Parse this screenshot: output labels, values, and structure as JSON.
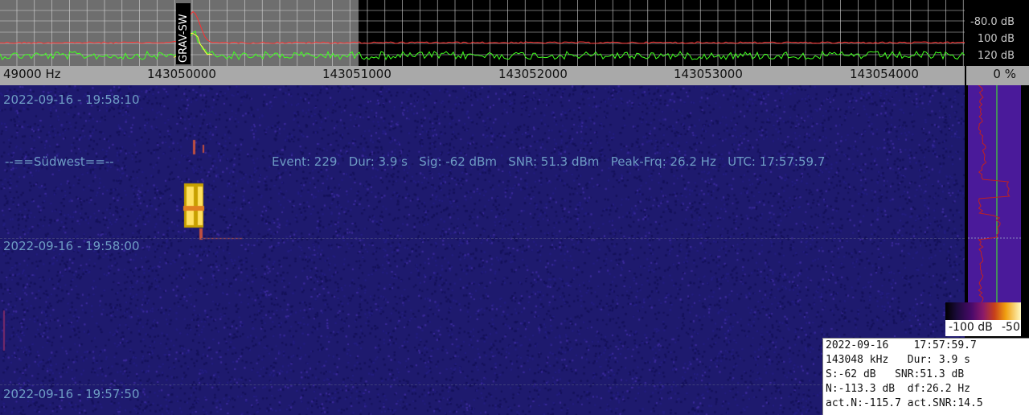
{
  "spectrum": {
    "db_labels": [
      "-80.0 dB",
      "100 dB",
      "120 dB"
    ],
    "marker_label": "GRAV-SW"
  },
  "freq_axis": {
    "labels": [
      "49000 Hz",
      "143050000",
      "143051000",
      "143052000",
      "143053000",
      "143054000"
    ],
    "percent": "0 %"
  },
  "waterfall": {
    "timestamps": [
      "2022-09-16 - 19:58:10",
      "2022-09-16 - 19:58:00",
      "2022-09-16 - 19:57:50"
    ],
    "station": "--==Südwest==--",
    "event_line": "Event: 229   Dur: 3.9 s   Sig: -62 dBm   SNR: 51.3 dBm   Peak-Frq: 26.2 Hz   UTC: 17:57:59.7"
  },
  "colorbar": {
    "min_label": "-100 dB",
    "max_label": "-50"
  },
  "info": {
    "lines": [
      "2022-09-16    17:57:59.7",
      "143048 kHz   Dur: 3.9 s",
      "S:-62 dB   SNR:51.3 dB",
      "N:-113.3 dB  df:26.2 Hz",
      "act.N:-115.7 act.SNR:14.5"
    ]
  },
  "colors": {
    "background_gray": "#6e6e6e",
    "grid": "#d8d8d8",
    "trace_red": "#ff3030",
    "trace_green": "#40ff20",
    "trace_yellow": "#ffff40",
    "waterfall_bg": "#1e1a6e"
  }
}
